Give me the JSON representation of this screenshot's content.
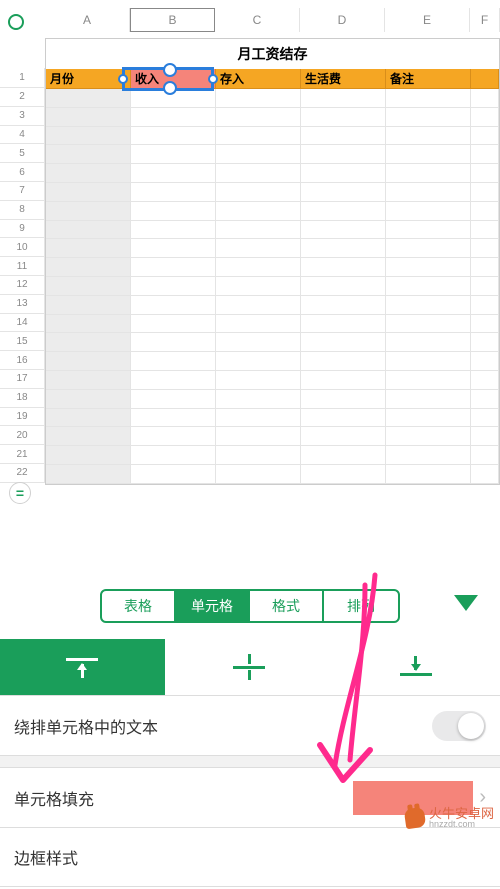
{
  "columns": [
    "A",
    "B",
    "C",
    "D",
    "E",
    "F"
  ],
  "selected_column_index": 1,
  "row_count": 22,
  "sheet": {
    "title": "月工资结存",
    "headers": [
      "月份",
      "收入",
      "存入",
      "生活费",
      "备注",
      ""
    ],
    "selected_header_index": 1
  },
  "tabs": {
    "items": [
      "表格",
      "单元格",
      "格式",
      "排列"
    ],
    "active_index": 1
  },
  "align_strip": {
    "active_index": 0
  },
  "settings": {
    "wrap_label": "绕排单元格中的文本",
    "wrap_on": false,
    "fill_label": "单元格填充",
    "fill_color": "#f5847a",
    "border_label": "边框样式"
  },
  "watermark": {
    "cn": "火牛安卓网",
    "en": "hnzzdt.com"
  }
}
